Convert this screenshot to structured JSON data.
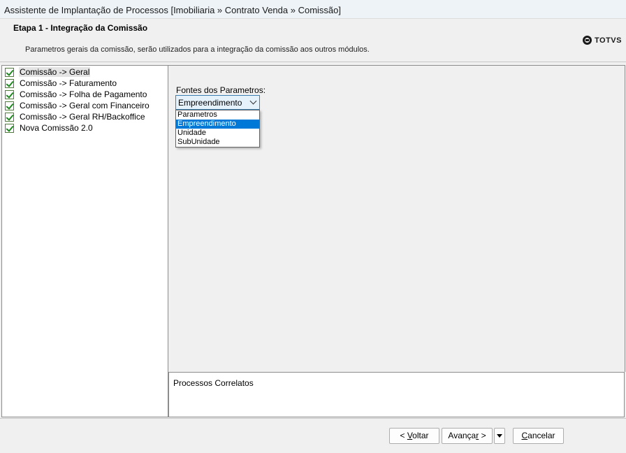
{
  "window": {
    "title": "Assistente de Implantação de Processos [Imobiliaria » Contrato Venda » Comissão]"
  },
  "header": {
    "step_title": "Etapa 1 - Integração da Comissão",
    "step_desc": "Parametros gerais da comissão, serão utilizados para a integração da comissão aos outros módulos.",
    "logo_text": "TOTVS"
  },
  "tree": {
    "items": [
      {
        "label": "Comissão -> Geral",
        "checked": true,
        "selected": true
      },
      {
        "label": "Comissão -> Faturamento",
        "checked": true,
        "selected": false
      },
      {
        "label": "Comissão -> Folha de Pagamento",
        "checked": true,
        "selected": false
      },
      {
        "label": "Comissão -> Geral com Financeiro",
        "checked": true,
        "selected": false
      },
      {
        "label": "Comissão -> Geral RH/Backoffice",
        "checked": true,
        "selected": false
      },
      {
        "label": "Nova Comissão 2.0",
        "checked": true,
        "selected": false
      }
    ]
  },
  "form": {
    "fontes_label": "Fontes dos Parametros:",
    "combo_value": "Empreendimento",
    "options": [
      "Parametros",
      "Empreendimento",
      "Unidade",
      "SubUnidade"
    ],
    "highlighted_option": "Empreendimento"
  },
  "related": {
    "title": "Processos Correlatos"
  },
  "footer": {
    "voltar_prefix": "< ",
    "voltar_ul": "V",
    "voltar_rest": "oltar",
    "avancar_pre": "Avança",
    "avancar_ul": "r",
    "avancar_post": " >",
    "cancelar_ul": "C",
    "cancelar_rest": "ancelar"
  },
  "colors": {
    "highlight": "#0078d7",
    "combo_bg": "#e5f1fb",
    "check": "#1e8a1e"
  }
}
